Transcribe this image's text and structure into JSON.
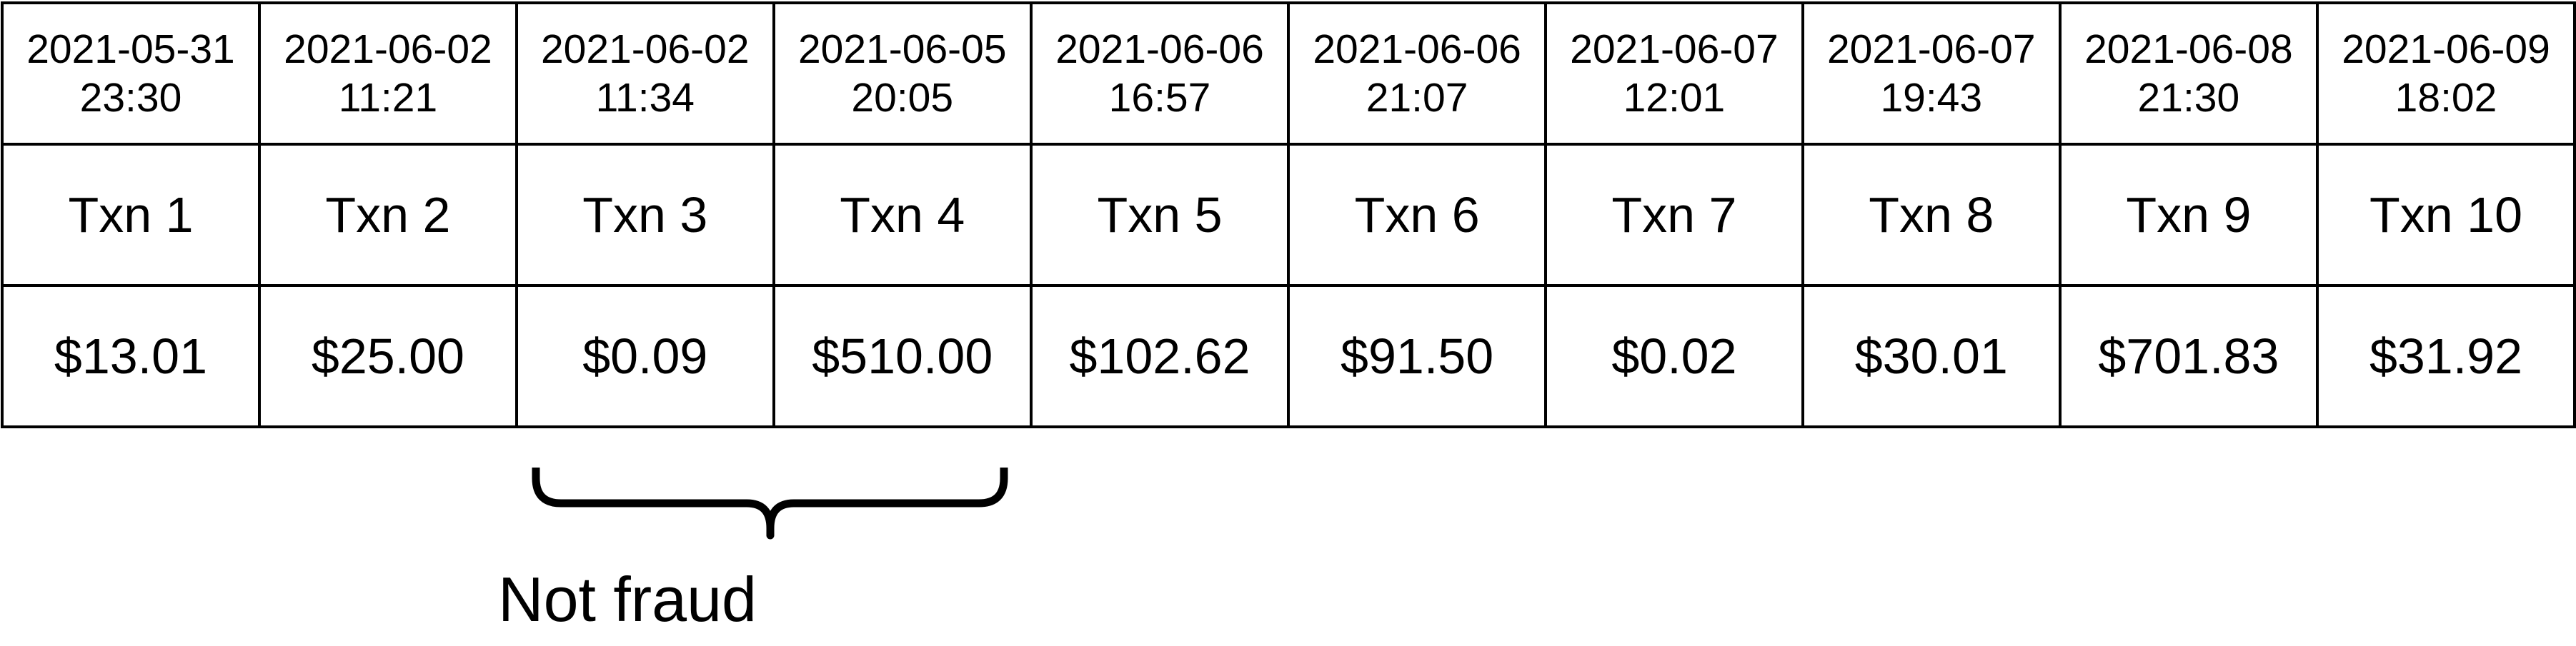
{
  "transactions": [
    {
      "date": "2021-05-31",
      "time": "23:30",
      "label": "Txn 1",
      "amount": "$13.01"
    },
    {
      "date": "2021-06-02",
      "time": "11:21",
      "label": "Txn 2",
      "amount": "$25.00"
    },
    {
      "date": "2021-06-02",
      "time": "11:34",
      "label": "Txn 3",
      "amount": "$0.09"
    },
    {
      "date": "2021-06-05",
      "time": "20:05",
      "label": "Txn 4",
      "amount": "$510.00"
    },
    {
      "date": "2021-06-06",
      "time": "16:57",
      "label": "Txn 5",
      "amount": "$102.62"
    },
    {
      "date": "2021-06-06",
      "time": "21:07",
      "label": "Txn 6",
      "amount": "$91.50"
    },
    {
      "date": "2021-06-07",
      "time": "12:01",
      "label": "Txn 7",
      "amount": "$0.02"
    },
    {
      "date": "2021-06-07",
      "time": "19:43",
      "label": "Txn 8",
      "amount": "$30.01"
    },
    {
      "date": "2021-06-08",
      "time": "21:30",
      "label": "Txn 9",
      "amount": "$701.83"
    },
    {
      "date": "2021-06-09",
      "time": "18:02",
      "label": "Txn 10",
      "amount": "$31.92"
    }
  ],
  "annotation": {
    "label": "Not fraud",
    "covers": [
      "Txn 3",
      "Txn 4"
    ]
  }
}
